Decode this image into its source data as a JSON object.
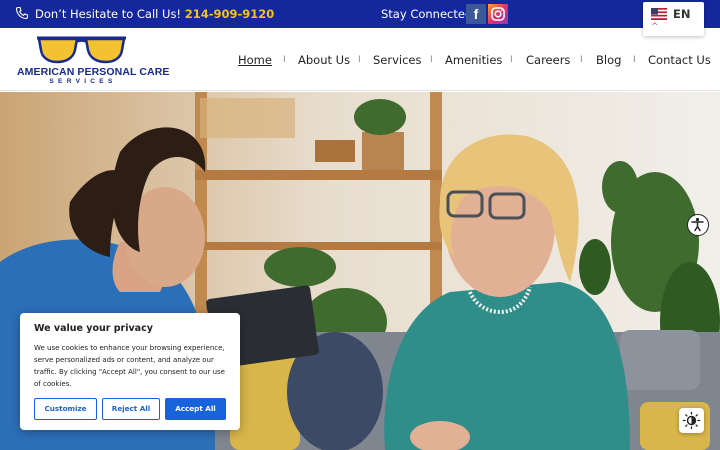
{
  "topbar": {
    "call_prefix": "Don’t Hesitate to Call Us!",
    "phone": "214-909-9120",
    "stay_connected": "Stay Connected",
    "social_facebook_glyph": "f",
    "bg_color": "#14279c",
    "phone_color": "#f4c318"
  },
  "language": {
    "code": "EN",
    "caret": "^"
  },
  "logo": {
    "name": "AMERICAN PERSONAL CARE",
    "sub": "SERVICES",
    "brand_color": "#18298f",
    "lens_color": "#f2c230"
  },
  "nav": {
    "items": [
      {
        "label": "Home",
        "active": true
      },
      {
        "label": "About Us"
      },
      {
        "label": "Services"
      },
      {
        "label": "Amenities"
      },
      {
        "label": "Careers"
      },
      {
        "label": "Blog"
      },
      {
        "label": "Contact Us"
      }
    ],
    "separator": "I"
  },
  "cookie": {
    "title": "We value your privacy",
    "body": "We use cookies to enhance your browsing experience, serve personalized ads or content, and analyze our traffic. By clicking \"Accept All\", you consent to our use of cookies.",
    "customize": "Customize",
    "reject": "Reject All",
    "accept": "Accept All",
    "accent_color": "#1863dc"
  },
  "widgets": {
    "accessibility_icon": "accessibility-icon",
    "contrast_icon": "contrast-toggle-icon"
  }
}
